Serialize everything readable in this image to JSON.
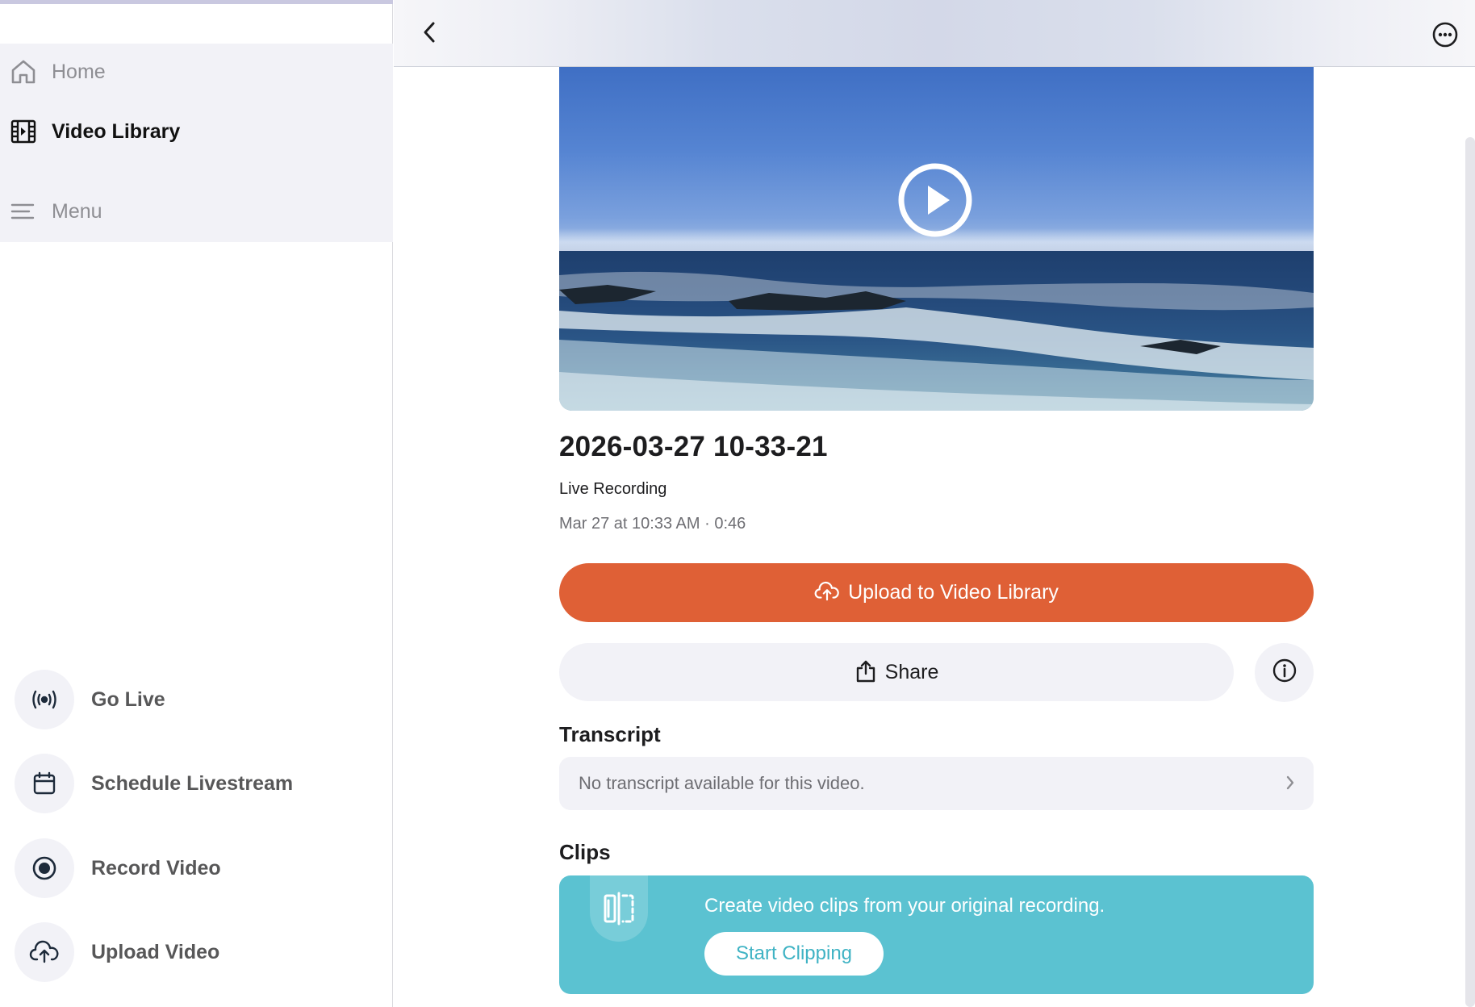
{
  "sidebar": {
    "nav": {
      "home": "Home",
      "video_library": "Video Library",
      "menu": "Menu"
    },
    "actions": {
      "go_live": "Go Live",
      "schedule": "Schedule Livestream",
      "record": "Record Video",
      "upload": "Upload Video"
    }
  },
  "icons": {
    "back": "chevron-left-icon",
    "more": "ellipsis-circle-icon",
    "play": "play-circle-icon",
    "upload": "cloud-upload-icon",
    "share": "share-icon",
    "info": "info-icon",
    "chevron": "chevron-right-icon",
    "clips": "clip-split-icon"
  },
  "video": {
    "title": "2026-03-27 10-33-21",
    "subtitle": "Live Recording",
    "meta": "Mar 27 at 10:33 AM · 0:46"
  },
  "buttons": {
    "upload": "Upload to Video Library",
    "share": "Share"
  },
  "transcript": {
    "title": "Transcript",
    "empty_text": "No transcript available for this video."
  },
  "clips": {
    "title": "Clips",
    "description": "Create video clips from your original recording.",
    "button": "Start Clipping"
  },
  "colors": {
    "accent": "#df6036",
    "clips_card": "#5bc2d1"
  }
}
